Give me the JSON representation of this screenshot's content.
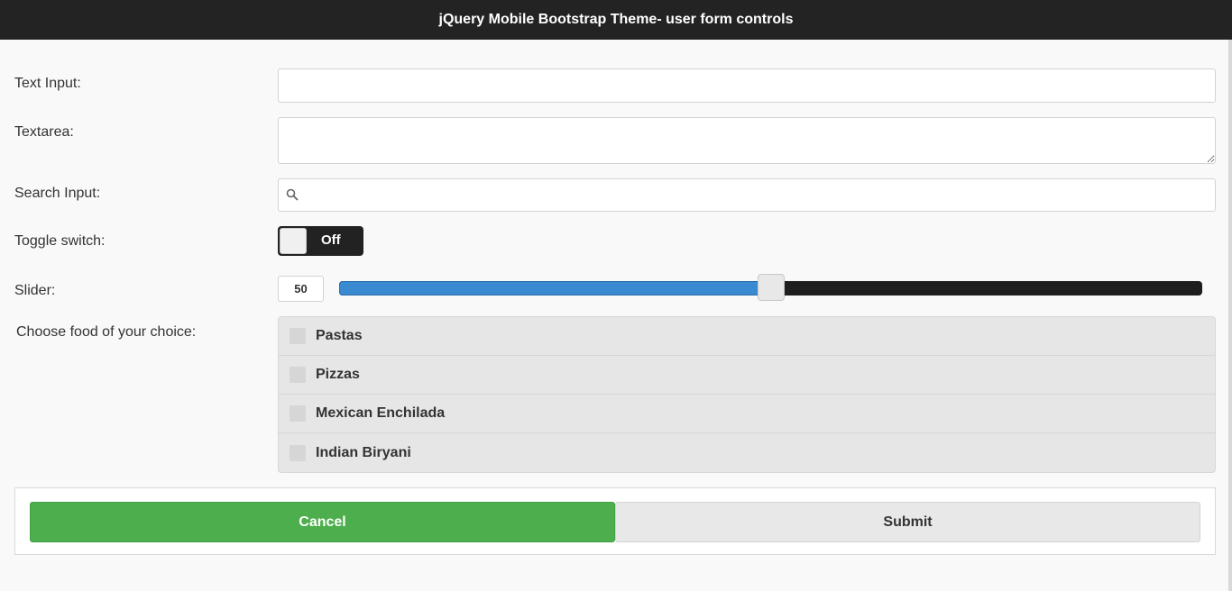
{
  "header": {
    "title": "jQuery Mobile Bootstrap Theme- user form controls"
  },
  "form": {
    "text_input": {
      "label": "Text Input:",
      "value": "",
      "placeholder": ""
    },
    "textarea": {
      "label": "Textarea:",
      "value": ""
    },
    "search_input": {
      "label": "Search Input:",
      "value": "",
      "icon": "search-icon"
    },
    "toggle": {
      "label": "Toggle switch:",
      "state": "Off"
    },
    "slider": {
      "label": "Slider:",
      "value": "50",
      "min": 0,
      "max": 100,
      "fill_fraction": 0.5
    },
    "food": {
      "label": "Choose food of your choice:",
      "options": [
        {
          "label": "Pastas",
          "checked": false
        },
        {
          "label": "Pizzas",
          "checked": false
        },
        {
          "label": "Mexican Enchilada",
          "checked": false
        },
        {
          "label": "Indian Biryani",
          "checked": false
        }
      ]
    }
  },
  "buttons": {
    "cancel_label": "Cancel",
    "submit_label": "Submit"
  },
  "colors": {
    "header_bg": "#232323",
    "slider_fill": "#3a8ad1",
    "cancel_bg": "#4cae4c",
    "submit_bg": "#e8e8e8"
  }
}
